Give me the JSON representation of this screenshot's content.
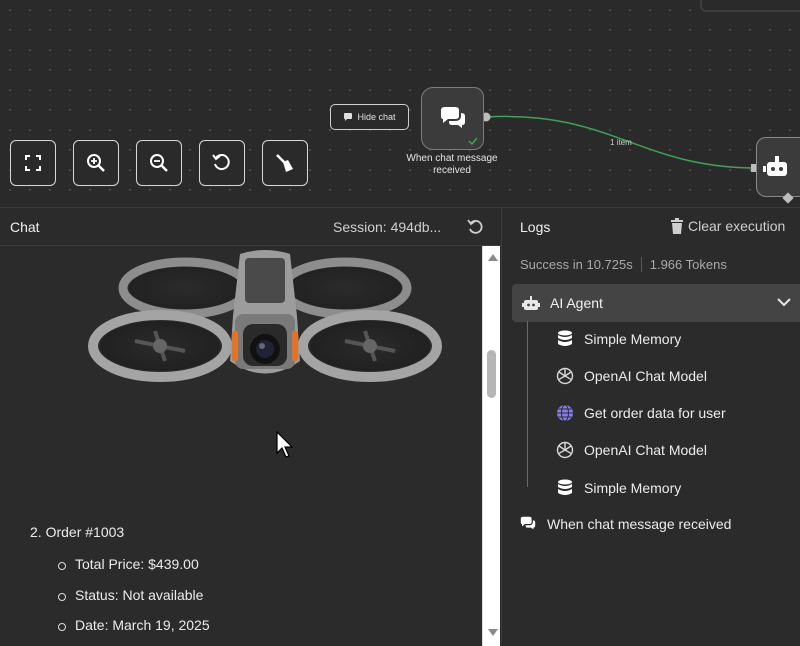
{
  "canvas": {
    "hide_chat_label": "Hide chat",
    "trigger_node_label": "When chat message received",
    "connection_label": "1 item",
    "controls": [
      "zoom-to-fit",
      "zoom-in",
      "zoom-out",
      "reset-zoom",
      "clear-execution"
    ]
  },
  "chat": {
    "title": "Chat",
    "session": "Session: 494db...",
    "order_title": "2. Order #1003",
    "order_items": [
      "Total Price: $439.00",
      "Status: Not available",
      "Date: March 19, 2025"
    ]
  },
  "logs": {
    "title": "Logs",
    "clear_label": "Clear execution",
    "success_text": "Success in 10.725s",
    "tokens_text": "1.966 Tokens",
    "agent_label": "AI Agent",
    "sub_items": [
      {
        "label": "Simple Memory",
        "icon": "database-icon"
      },
      {
        "label": "OpenAI Chat Model",
        "icon": "openai-icon"
      },
      {
        "label": "Get order data for user",
        "icon": "globe-icon"
      },
      {
        "label": "OpenAI Chat Model",
        "icon": "openai-icon"
      },
      {
        "label": "Simple Memory",
        "icon": "database-icon"
      }
    ],
    "trigger_label": "When chat message received"
  },
  "colors": {
    "connection": "#3fa35a",
    "globe": "#8a7cf0",
    "background": "#2b2b2b"
  }
}
